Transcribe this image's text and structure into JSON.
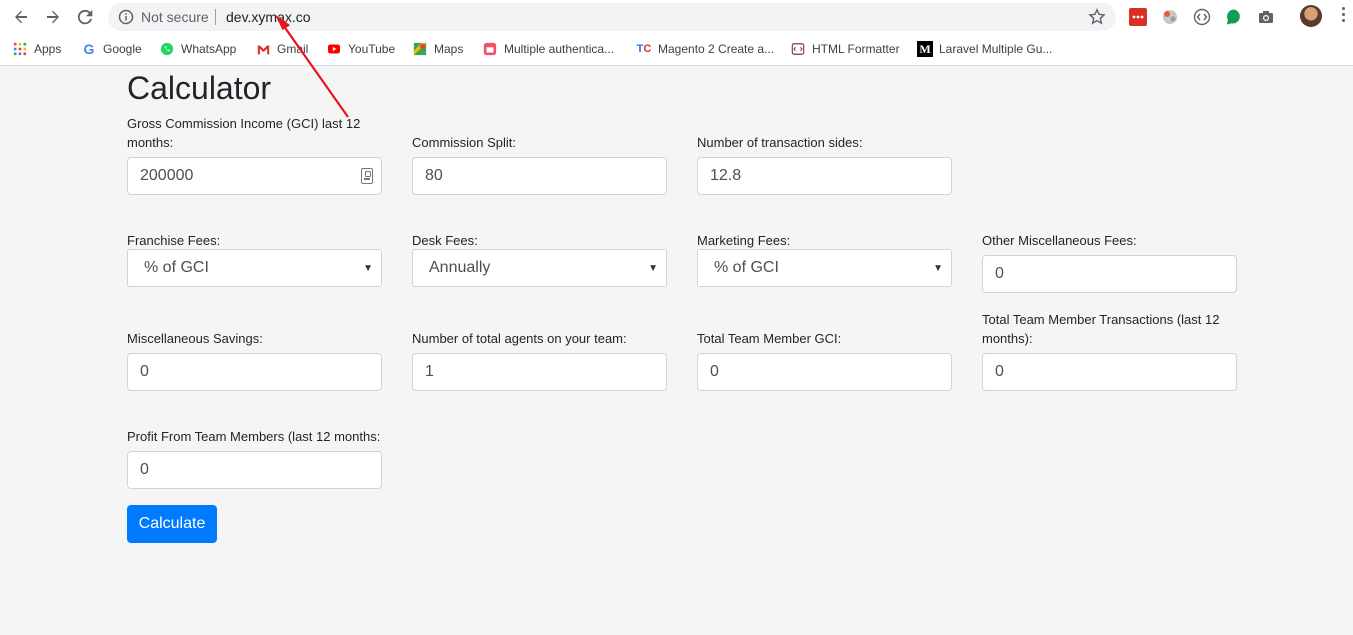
{
  "browser": {
    "security_label": "Not secure",
    "url": "dev.xymax.co",
    "bookmarks": [
      {
        "label": "Apps",
        "icon": "apps-grid-icon"
      },
      {
        "label": "Google",
        "icon": "google-icon"
      },
      {
        "label": "WhatsApp",
        "icon": "whatsapp-icon"
      },
      {
        "label": "Gmail",
        "icon": "gmail-icon"
      },
      {
        "label": "YouTube",
        "icon": "youtube-icon"
      },
      {
        "label": "Maps",
        "icon": "maps-icon"
      },
      {
        "label": "Multiple authentica...",
        "icon": "bookmark-pink-icon"
      },
      {
        "label": "Magento 2 Create a...",
        "icon": "tc-icon"
      },
      {
        "label": "HTML Formatter",
        "icon": "html-formatter-icon"
      },
      {
        "label": "Laravel Multiple Gu...",
        "icon": "medium-icon"
      }
    ],
    "colors": {
      "accent": "#007bff",
      "annotation": "#e8141d"
    }
  },
  "page": {
    "title": "Calculator",
    "fields": {
      "gci": {
        "label": "Gross Commission Income (GCI) last 12 months:",
        "value": "200000"
      },
      "commission_split": {
        "label": "Commission Split:",
        "value": "80"
      },
      "transaction_sides": {
        "label": "Number of transaction sides:",
        "value": "12.8"
      },
      "franchise_fees": {
        "label": "Franchise Fees:",
        "value": "% of GCI"
      },
      "desk_fees": {
        "label": "Desk Fees:",
        "value": "Annually"
      },
      "marketing_fees": {
        "label": "Marketing Fees:",
        "value": "% of GCI"
      },
      "other_misc_fees": {
        "label": "Other Miscellaneous Fees:",
        "value": "0"
      },
      "misc_savings": {
        "label": "Miscellaneous Savings:",
        "value": "0"
      },
      "total_agents": {
        "label": "Number of total agents on your team:",
        "value": "1"
      },
      "team_member_gci": {
        "label": "Total Team Member GCI:",
        "value": "0"
      },
      "team_member_transactions": {
        "label": "Total Team Member Transactions (last 12 months):",
        "value": "0"
      },
      "profit_team_members": {
        "label": "Profit From Team Members (last 12 months:",
        "value": "0"
      }
    },
    "calculate_label": "Calculate"
  }
}
